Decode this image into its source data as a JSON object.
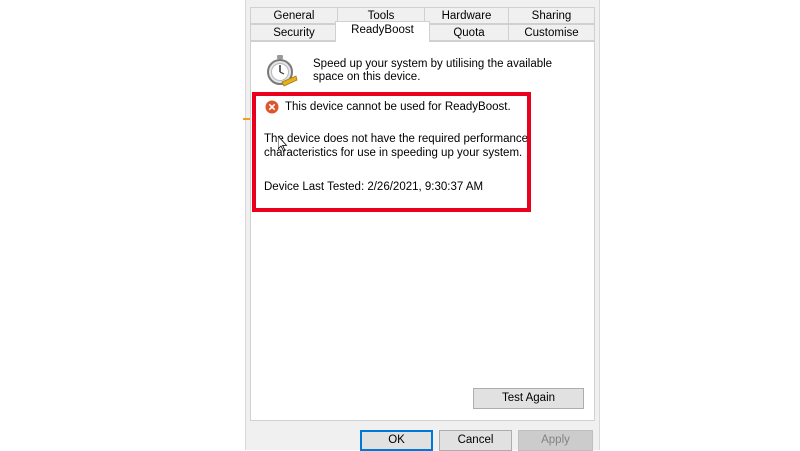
{
  "tabs": {
    "row1": [
      "General",
      "Tools",
      "Hardware",
      "Sharing"
    ],
    "row2": [
      "Security",
      "ReadyBoost",
      "Quota",
      "Customise"
    ],
    "active": "ReadyBoost"
  },
  "readyboost": {
    "icon": "readyboost-stopwatch-icon",
    "intro": "Speed up your system by utilising the available space on this device.",
    "warning_icon": "error-x-icon",
    "warning": "This device cannot be used for ReadyBoost.",
    "description": "The device does not have the required performance characteristics for use in speeding up your system.",
    "last_tested": "Device Last Tested: 2/26/2021, 9:30:37 AM",
    "test_again_label": "Test Again"
  },
  "footer": {
    "ok_label": "OK",
    "cancel_label": "Cancel",
    "apply_label": "Apply"
  },
  "colors": {
    "highlight_border": "#e8001c",
    "error_icon": "#e0542c",
    "dialog_bg": "#f0f0f0",
    "panel_bg": "#ffffff",
    "default_button_border": "#0078d7"
  }
}
